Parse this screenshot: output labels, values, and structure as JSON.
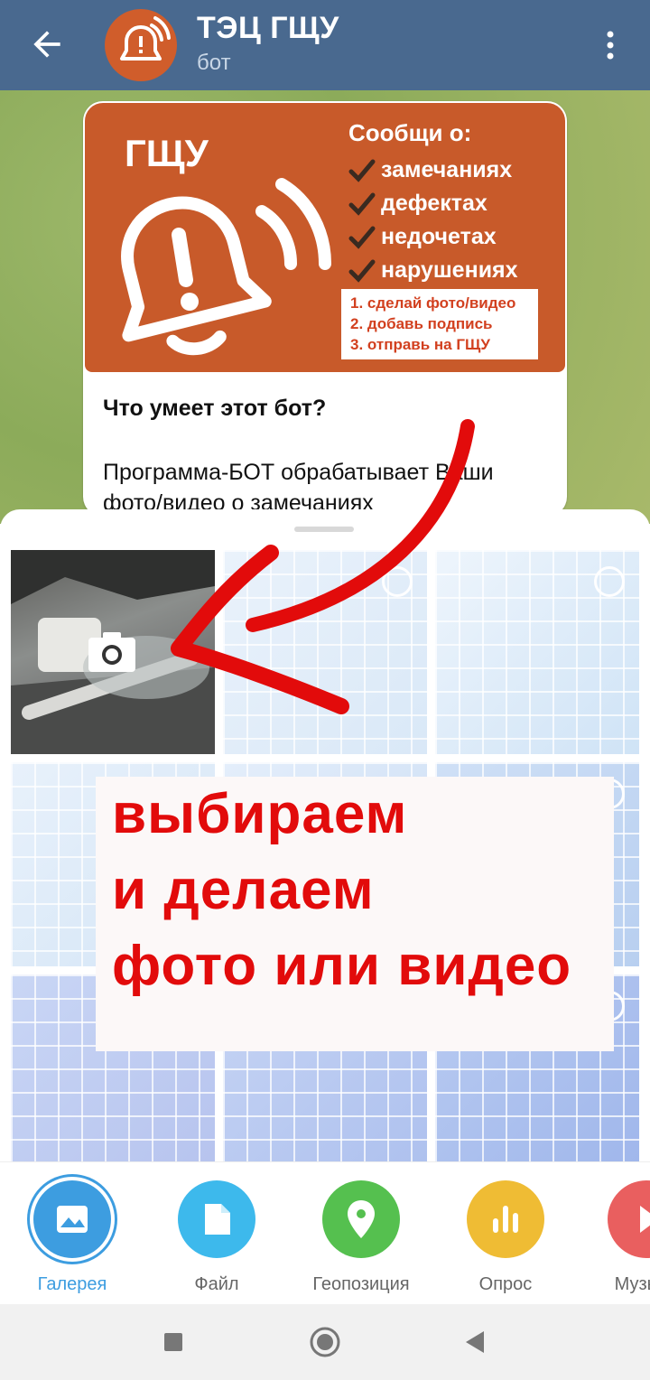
{
  "header": {
    "title": "ТЭЦ ГЩУ",
    "subtitle": "бот"
  },
  "message": {
    "banner": {
      "brand": "ГЩУ",
      "report_heading": "Сообщи о:",
      "checklist": [
        "замечаниях",
        "дефектах",
        "недочетах",
        "нарушениях"
      ],
      "steps": [
        "1. сделай фото/видео",
        "2. добавь подпись",
        "3. отправь на ГЩУ"
      ]
    },
    "heading": "Что умеет этот бот?",
    "text": "Программа-БОТ обрабатывает Ваши фото/видео о замечаниях"
  },
  "annotation": {
    "lines": [
      "выбираем",
      "и делаем",
      "фото или видео"
    ]
  },
  "attach_tabs": [
    {
      "label": "Галерея",
      "icon": "gallery-icon",
      "color": "#3d9de0",
      "active": true
    },
    {
      "label": "Файл",
      "icon": "file-icon",
      "color": "#3db9ec",
      "active": false
    },
    {
      "label": "Геопозиция",
      "icon": "location-icon",
      "color": "#55c04f",
      "active": false
    },
    {
      "label": "Опрос",
      "icon": "poll-icon",
      "color": "#efbc34",
      "active": false
    },
    {
      "label": "Музыка",
      "icon": "music-icon",
      "color": "#e95f5f",
      "active": false
    }
  ],
  "colors": {
    "header": "#49698f",
    "accent": "#3d9de0",
    "annotation": "#e20b0b",
    "banner": "#c85a2a"
  }
}
